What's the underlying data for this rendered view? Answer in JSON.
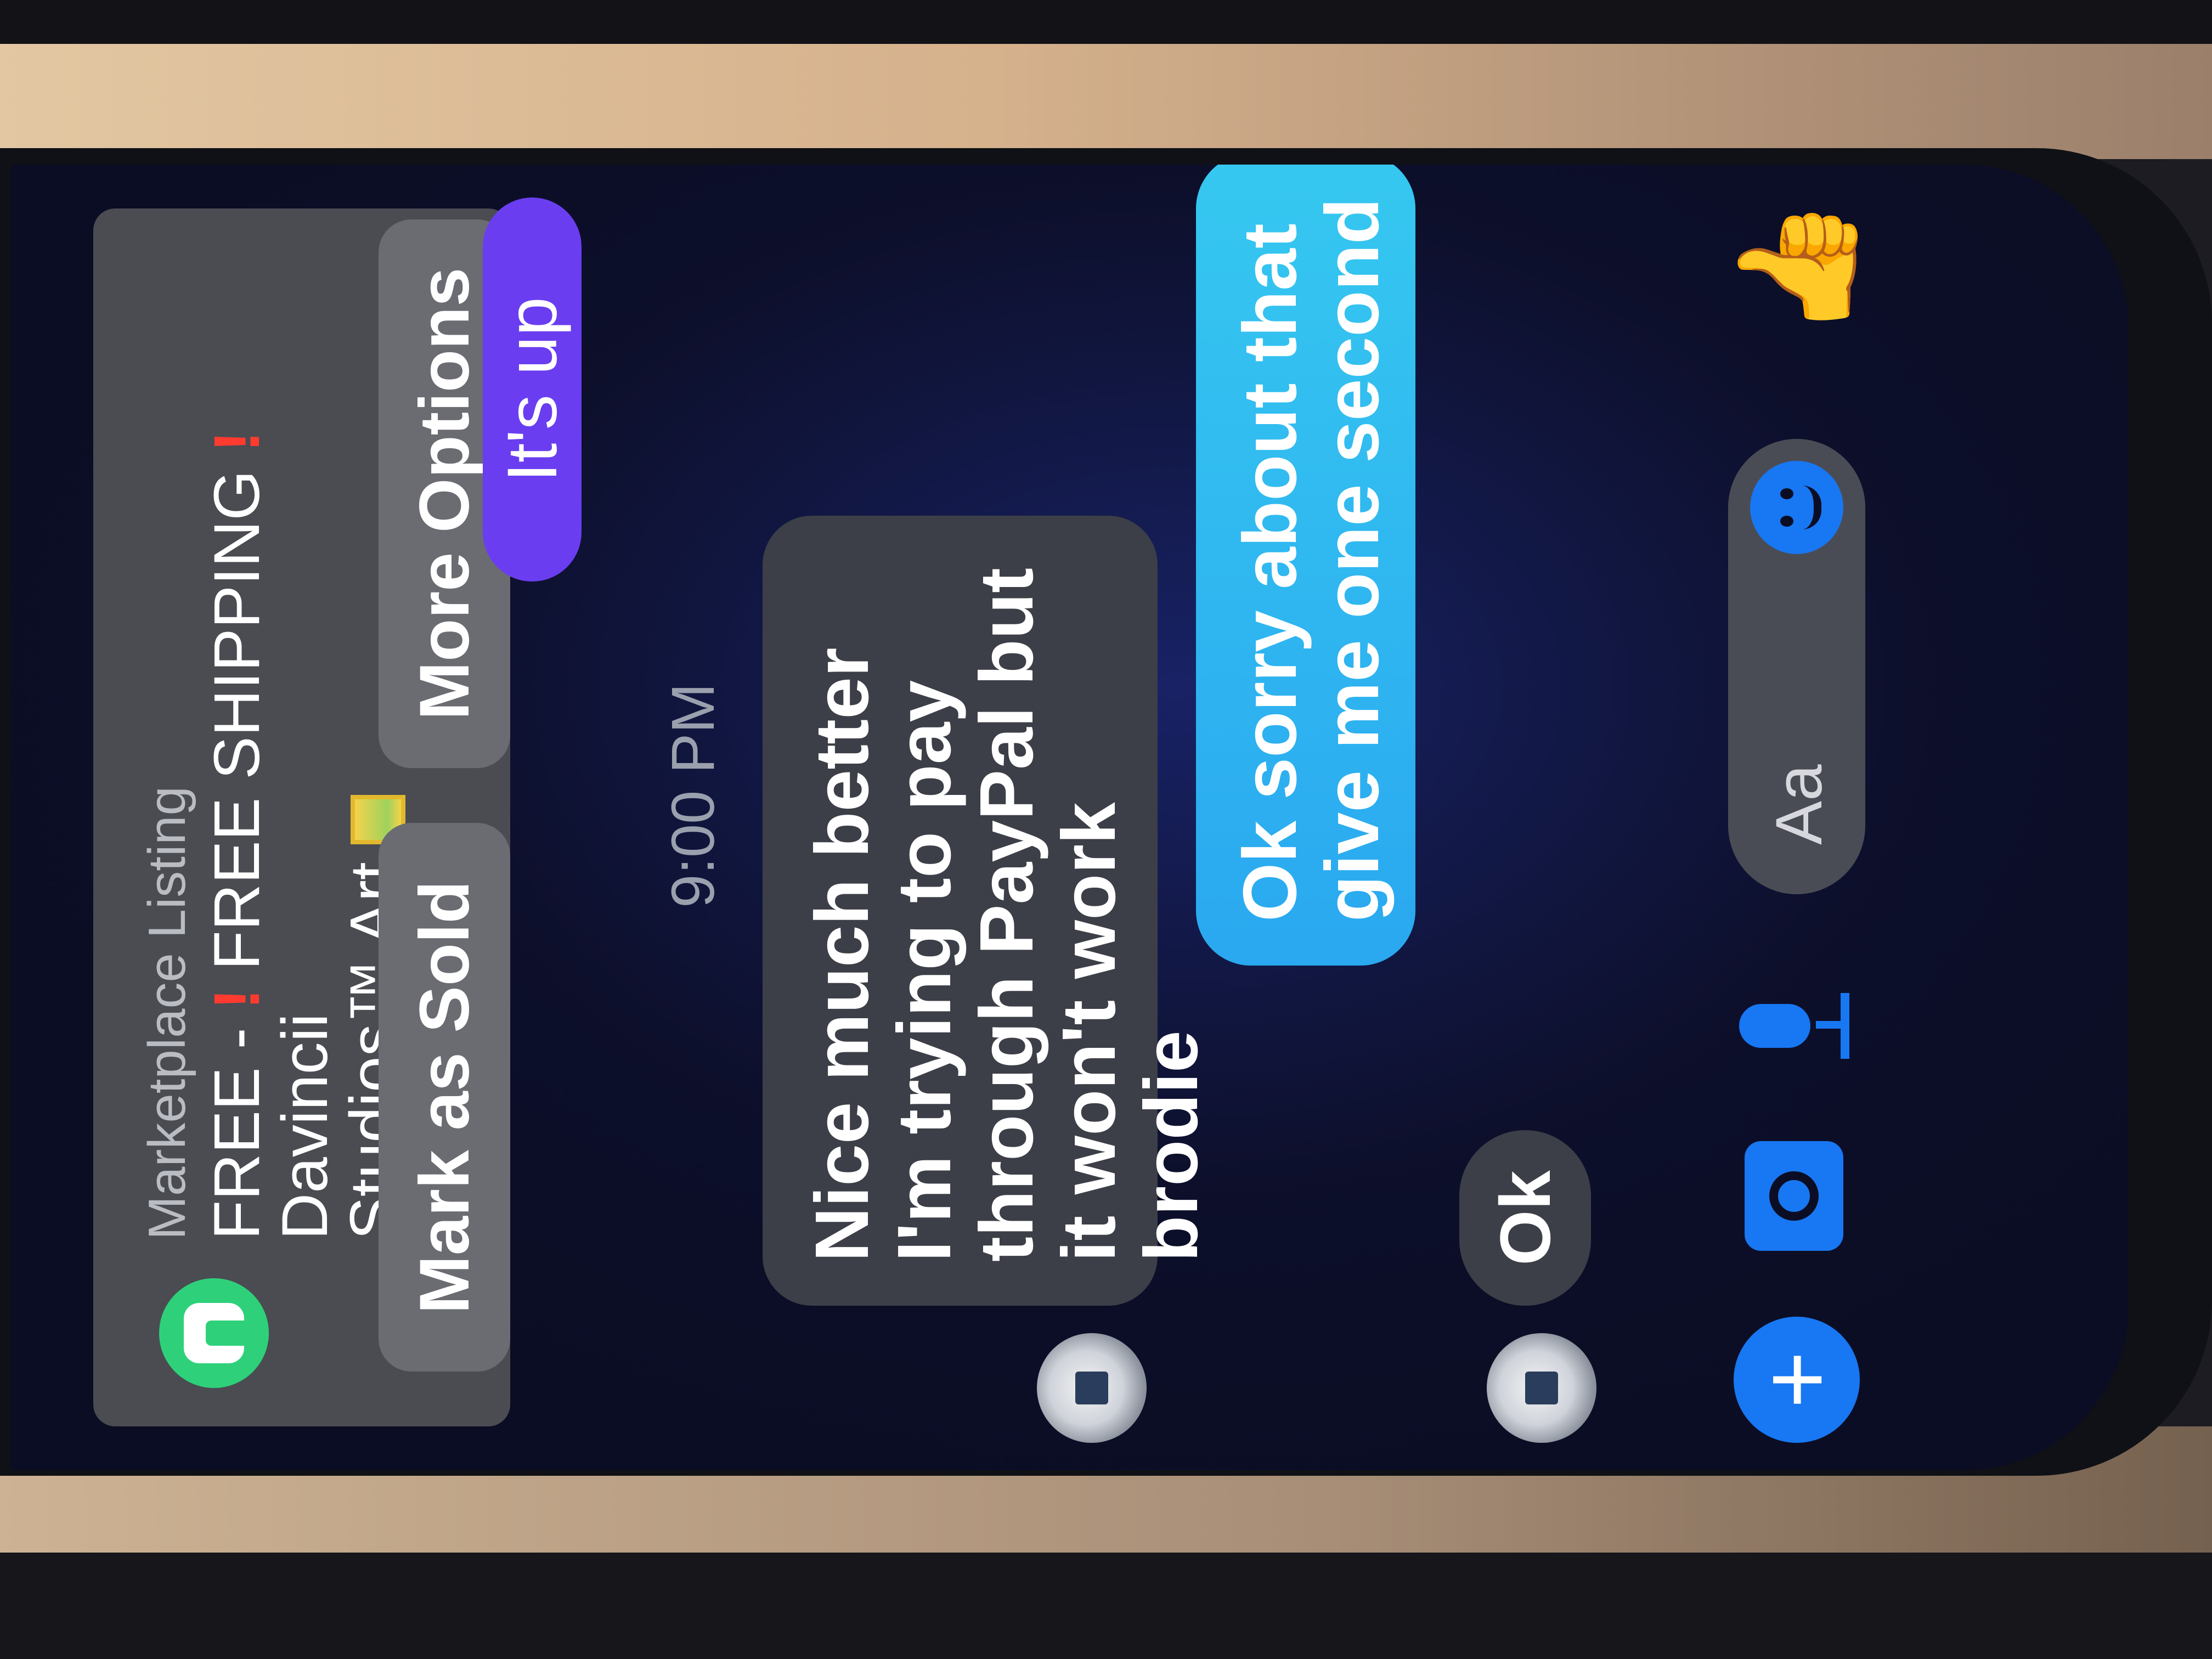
{
  "notification": {
    "app_icon": "marketplace-icon",
    "title": "Marketplace Listing",
    "body_line1_prefix": "FREE - ",
    "exclaim": "!",
    "body_line1_mid": " FREE SHIPPING ",
    "body_line1_suffix": " Davincii",
    "body_line2": "Studios™ Art ",
    "mark_sold_label": "Mark as Sold",
    "more_options_label": "More Options"
  },
  "conversation": {
    "sent_purple": "It's up",
    "timestamp": "9:00 PM",
    "received_1": "Nice much better I'm trying to pay through PayPal but it won't work brodie",
    "sent_blue": "Ok sorry about that give me one second",
    "received_2": "Ok"
  },
  "composer": {
    "plus_icon": "plus-icon",
    "plus_glyph": "+",
    "camera_icon": "camera-icon",
    "mic_icon": "microphone-icon",
    "placeholder": "Aa",
    "emoji_icon": "emoji-icon",
    "like_icon": "thumbs-up-icon",
    "like_glyph": "👍"
  },
  "colors": {
    "screen_bg": "#0b0d24",
    "notification_bg": "#4a4c52",
    "purple_bubble": "#6a3ef0",
    "blue_bubble": "#36c8f0",
    "gray_bubble": "#3c3f47",
    "accent": "#1877f2",
    "marketplace_green": "#2ed17a",
    "exclaim_red": "#ff3b30"
  }
}
